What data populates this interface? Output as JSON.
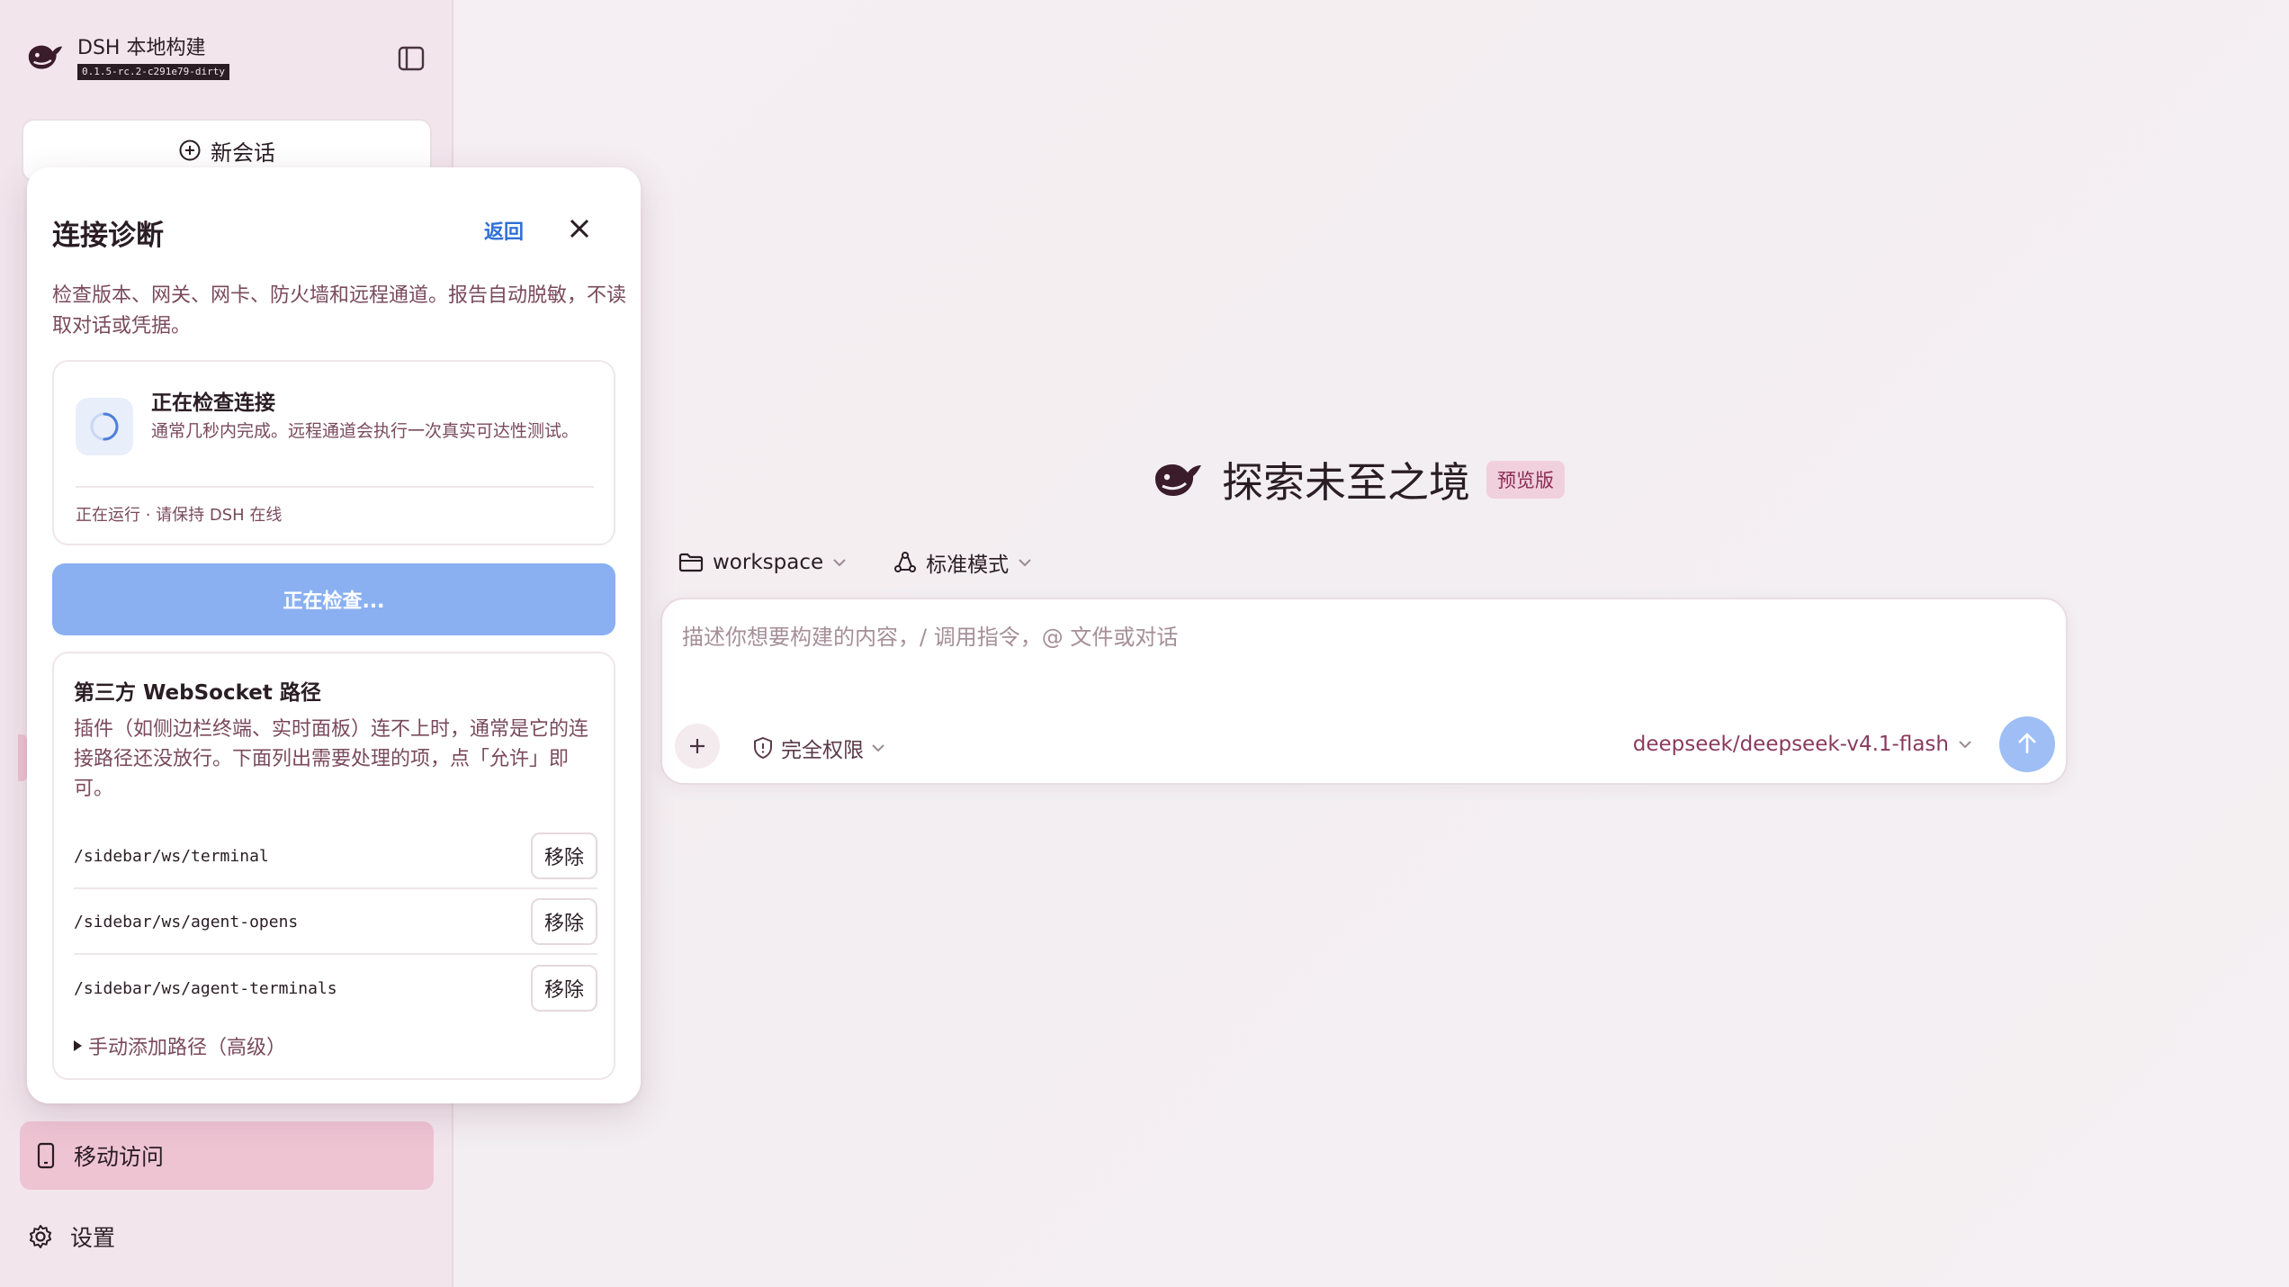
{
  "sidebar": {
    "brand_name": "DSH 本地构建",
    "brand_version": "0.1.5-rc.2-c291e79-dirty",
    "new_chat_label": "新会话",
    "mobile_access_label": "移动访问",
    "settings_label": "设置"
  },
  "panel": {
    "title": "连接诊断",
    "back_label": "返回",
    "description": "检查版本、网关、网卡、防火墙和远程通道。报告自动脱敏，不读取对话或凭据。",
    "status": {
      "title": "正在检查连接",
      "description": "通常几秒内完成。远程通道会执行一次真实可达性测试。",
      "footer": "正在运行 · 请保持 DSH 在线"
    },
    "checking_button": "正在检查...",
    "websocket": {
      "title": "第三方 WebSocket 路径",
      "description": "插件（如侧边栏终端、实时面板）连不上时，通常是它的连接路径还没放行。下面列出需要处理的项，点「允许」即可。",
      "paths": [
        {
          "path": "/sidebar/ws/terminal",
          "action": "移除"
        },
        {
          "path": "/sidebar/ws/agent-opens",
          "action": "移除"
        },
        {
          "path": "/sidebar/ws/agent-terminals",
          "action": "移除"
        }
      ],
      "manual_add": "手动添加路径（高级）"
    }
  },
  "main": {
    "hero_title": "探索未至之境",
    "hero_badge": "预览版",
    "workspace_label": "workspace",
    "mode_label": "标准模式",
    "composer_placeholder": "描述你想要构建的内容，/ 调用指令，@ 文件或对话",
    "permission_label": "完全权限",
    "model_label": "deepseek/deepseek-v4.1-flash"
  },
  "colors": {
    "accent_pink": "#eec4d3",
    "link_blue": "#2f6fd6",
    "button_blue": "#8ab0f2"
  }
}
